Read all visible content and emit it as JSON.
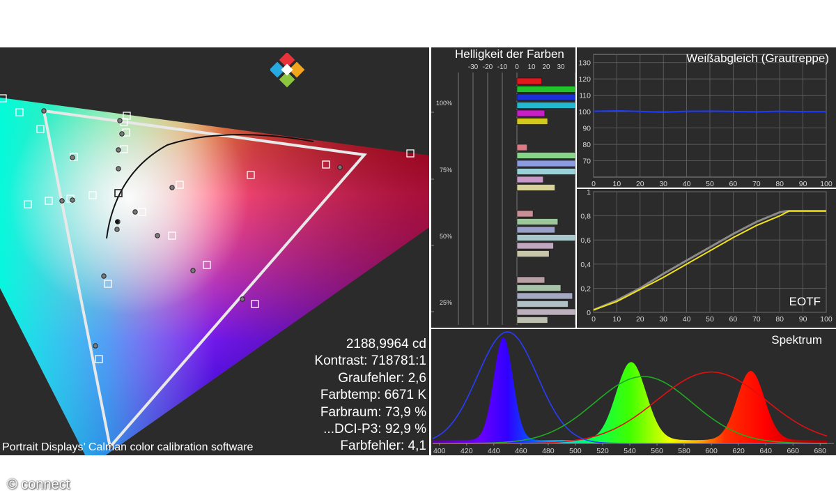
{
  "cie": {
    "caption": "Portrait Displays’ Calman color calibration software",
    "logo": "calman",
    "stats": [
      "2188,9964 cd",
      "Kontrast: 718781:1",
      "Graufehler: 2,6",
      "Farbtemp: 6671 K",
      "Farbraum: 73,9 %",
      "...DCI-P3: 92,9 %",
      "Farbfehler: 4,1"
    ]
  },
  "watermark": "© connect",
  "chart_data": [
    {
      "type": "bar",
      "title": "Helligkeit der Farben",
      "xlim": [
        -40,
        40
      ],
      "xticks": [
        -30,
        -20,
        -10,
        0,
        10,
        20,
        30
      ],
      "groups": [
        "100%",
        "75%",
        "50%",
        "25%"
      ],
      "bar_names": [
        "Rot",
        "Grün",
        "Blau",
        "Cyan",
        "Magenta",
        "Gelb"
      ],
      "values": [
        [
          17,
          40,
          40,
          40,
          19,
          21
        ],
        [
          7,
          40,
          40,
          40,
          18,
          26
        ],
        [
          11,
          28,
          26,
          40,
          25,
          22
        ],
        [
          19,
          30,
          38,
          35,
          40,
          21
        ]
      ],
      "colors": [
        [
          "#e2171d",
          "#22c22b",
          "#1a2fd6",
          "#23b8ce",
          "#c81ec8",
          "#d4c81c"
        ],
        [
          "#d97b84",
          "#88d488",
          "#8d9ce0",
          "#9ad0d8",
          "#c99ac9",
          "#d6d29a"
        ],
        [
          "#c89096",
          "#9cc89c",
          "#9aa0c8",
          "#a8c8cc",
          "#c0a8c0",
          "#c8c6a8"
        ],
        [
          "#b8a0a4",
          "#a8c4a8",
          "#a4a8c0",
          "#b0c0c4",
          "#bcb0bc",
          "#c0c0b0"
        ]
      ]
    },
    {
      "type": "line",
      "title": "Weißabgleich (Grautreppe)",
      "xlim": [
        0,
        100
      ],
      "ylim": [
        60,
        135
      ],
      "xticks": [
        0,
        10,
        20,
        30,
        40,
        50,
        60,
        70,
        80,
        90,
        100
      ],
      "yticks": [
        70,
        80,
        90,
        100,
        110,
        120,
        130
      ],
      "series": [
        {
          "color": "#1f3bff",
          "x": [
            0,
            10,
            20,
            30,
            40,
            50,
            60,
            70,
            80,
            90,
            100
          ],
          "y": [
            100.2,
            100.5,
            100.1,
            99.7,
            100.2,
            100.3,
            100.1,
            99.9,
            100.2,
            100.0,
            100.0
          ]
        }
      ]
    },
    {
      "type": "line",
      "title": "EOTF",
      "xlim": [
        0,
        100
      ],
      "ylim": [
        0,
        1
      ],
      "xticks": [
        0,
        10,
        20,
        30,
        40,
        50,
        60,
        70,
        80,
        90,
        100
      ],
      "yticks": [
        "0",
        "0,2",
        "0,4",
        "0,6",
        "0,8",
        "1"
      ],
      "ytick_values": [
        0,
        0.2,
        0.4,
        0.6,
        0.8,
        1
      ],
      "series": [
        {
          "color": "#8a8a8a",
          "x": [
            0,
            10,
            20,
            30,
            40,
            50,
            60,
            70,
            80,
            83,
            100
          ],
          "y": [
            0.02,
            0.1,
            0.2,
            0.32,
            0.43,
            0.54,
            0.65,
            0.75,
            0.83,
            0.84,
            0.84
          ]
        },
        {
          "color": "#f2e21a",
          "x": [
            0,
            10,
            20,
            30,
            40,
            50,
            60,
            70,
            80,
            84,
            100
          ],
          "y": [
            0.02,
            0.09,
            0.19,
            0.29,
            0.4,
            0.51,
            0.62,
            0.72,
            0.8,
            0.84,
            0.84
          ]
        }
      ]
    },
    {
      "type": "area",
      "title": "Spektrum",
      "xlim": [
        395,
        685
      ],
      "xticks": [
        400,
        420,
        440,
        460,
        480,
        500,
        520,
        540,
        560,
        580,
        600,
        620,
        640,
        660,
        680
      ],
      "peaks": [
        {
          "center": 447,
          "width": 7,
          "height": 0.92
        },
        {
          "center": 541,
          "width": 11,
          "height": 0.7
        },
        {
          "center": 629,
          "width": 10,
          "height": 0.62
        }
      ],
      "curves": [
        {
          "color": "#2a3cff",
          "center": 450,
          "width": 22,
          "height": 1.0
        },
        {
          "color": "#22aa22",
          "center": 550,
          "width": 36,
          "height": 0.6
        },
        {
          "color": "#e01010",
          "center": 600,
          "width": 40,
          "height": 0.64
        }
      ]
    },
    {
      "type": "scatter",
      "gamut_triangle": [
        [
          63,
          91
        ],
        [
          523,
          154
        ],
        [
          158,
          573
        ]
      ],
      "measured": [
        [
          63,
          91
        ],
        [
          172,
          105
        ],
        [
          175,
          124
        ],
        [
          170,
          147
        ],
        [
          104,
          158
        ],
        [
          488,
          172
        ],
        [
          170,
          174
        ],
        [
          247,
          201
        ],
        [
          89,
          220
        ],
        [
          104,
          219
        ],
        [
          169,
          250
        ],
        [
          168,
          261
        ],
        [
          194,
          236
        ],
        [
          226,
          270
        ],
        [
          277,
          320
        ],
        [
          149,
          328
        ],
        [
          348,
          361
        ],
        [
          137,
          428
        ],
        [
          158,
          573
        ]
      ],
      "targets": [
        [
          4,
          73
        ],
        [
          28,
          93
        ],
        [
          182,
          98
        ],
        [
          178,
          107
        ],
        [
          58,
          117
        ],
        [
          181,
          122
        ],
        [
          178,
          146
        ],
        [
          106,
          157
        ],
        [
          589,
          152
        ],
        [
          468,
          168
        ],
        [
          360,
          183
        ],
        [
          258,
          197
        ],
        [
          170,
          209
        ],
        [
          40,
          225
        ],
        [
          70,
          220
        ],
        [
          101,
          217
        ],
        [
          133,
          212
        ],
        [
          204,
          236
        ],
        [
          247,
          270
        ],
        [
          297,
          312
        ],
        [
          155,
          339
        ],
        [
          366,
          368
        ],
        [
          142,
          447
        ],
        [
          124,
          598
        ]
      ],
      "white_point": [
        170,
        209
      ]
    }
  ]
}
